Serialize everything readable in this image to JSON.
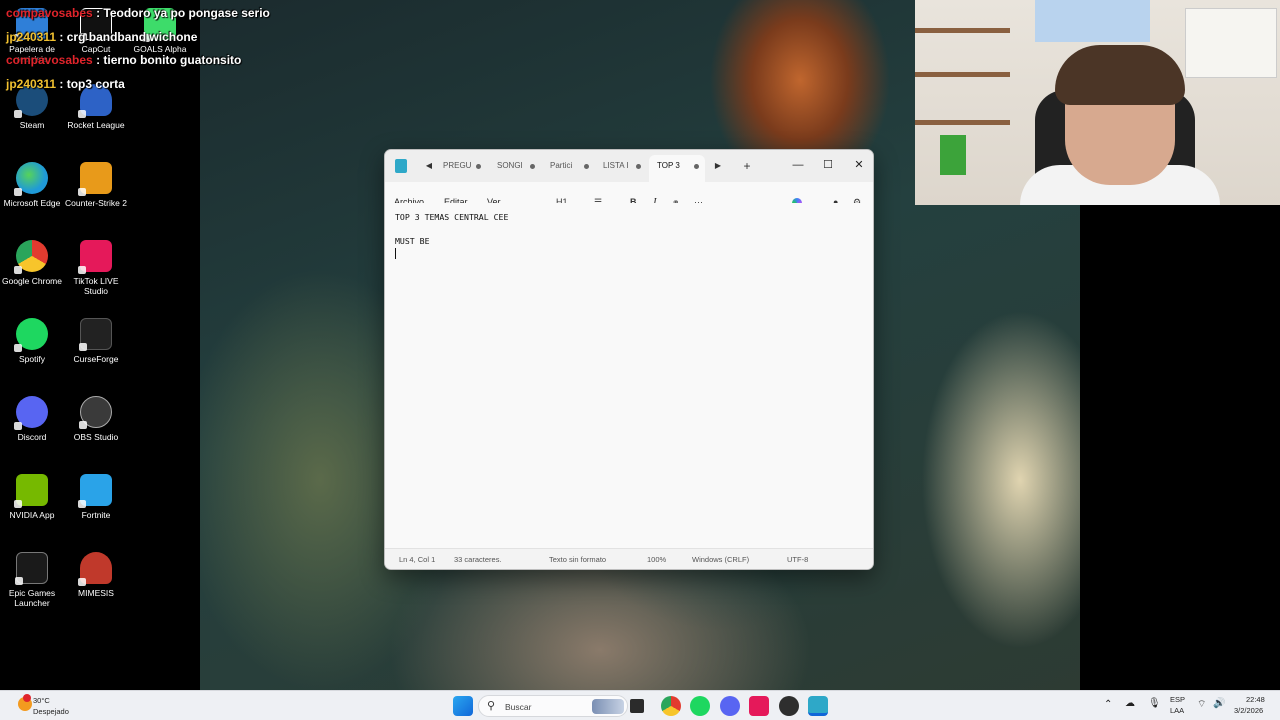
{
  "chat": [
    {
      "user": "compavosabes",
      "msg": "Teodoro ya po pongase serio",
      "color": "#e0242b"
    },
    {
      "user": "jp240311",
      "msg": "crg bandband wichone",
      "color": "#f0c030"
    },
    {
      "user": "compavosabes",
      "msg": "tierno bonito guatonsito",
      "color": "#e0242b"
    },
    {
      "user": "jp240311",
      "msg": "top3 corta",
      "color": "#f0c030"
    }
  ],
  "desktop_icons": [
    {
      "label": "Papelera de reciclaje",
      "icon": "recycle-bin-icon",
      "color": "#2f7fd8"
    },
    {
      "label": "CapCut",
      "icon": "capcut-icon",
      "color": "#111111"
    },
    {
      "label": "GOALS Alpha",
      "icon": "goals-icon",
      "color": "#3ddc6a"
    },
    {
      "label": "Steam",
      "icon": "steam-icon",
      "color": "#1b4d7a"
    },
    {
      "label": "Rocket League",
      "icon": "rocket-league-icon",
      "color": "#2d62c6"
    },
    {
      "label": "Microsoft Edge",
      "icon": "edge-icon",
      "color": "#1f9ad8"
    },
    {
      "label": "Counter-Strike 2",
      "icon": "counter-strike-icon",
      "color": "#e89a1a"
    },
    {
      "label": "Google Chrome",
      "icon": "chrome-icon",
      "color": "#e23b2f"
    },
    {
      "label": "TikTok LIVE Studio",
      "icon": "tiktok-icon",
      "color": "#e5195a"
    },
    {
      "label": "Spotify",
      "icon": "spotify-icon",
      "color": "#1ed760"
    },
    {
      "label": "CurseForge",
      "icon": "curseforge-icon",
      "color": "#222222"
    },
    {
      "label": "Discord",
      "icon": "discord-icon",
      "color": "#5865f2"
    },
    {
      "label": "OBS Studio",
      "icon": "obs-icon",
      "color": "#3a3a3a"
    },
    {
      "label": "NVIDIA App",
      "icon": "nvidia-icon",
      "color": "#76b900"
    },
    {
      "label": "Fortnite",
      "icon": "fortnite-icon",
      "color": "#2aa3e8"
    },
    {
      "label": "Epic Games Launcher",
      "icon": "epic-games-icon",
      "color": "#1a1a1a"
    },
    {
      "label": "MIMESIS",
      "icon": "mimesis-icon",
      "color": "#c0392b"
    }
  ],
  "notepad": {
    "tabs": [
      "PREGU",
      "SONGI",
      "Partici",
      "LISTA I",
      "TOP 3"
    ],
    "active_tab": "TOP 3",
    "menus": [
      "Archivo",
      "Editar",
      "Ver"
    ],
    "heading_select": "H1",
    "content": [
      "TOP 3 TEMAS CENTRAL CEE",
      "",
      "MUST BE",
      ""
    ],
    "status": {
      "position": "Ln 4, Col 1",
      "chars": "33 caracteres.",
      "format": "Texto sin formato",
      "zoom": "100%",
      "line_ending": "Windows (CRLF)",
      "encoding": "UTF-8"
    }
  },
  "taskbar": {
    "weather_temp": "30°C",
    "weather_desc": "Despejado",
    "search_placeholder": "Buscar",
    "language": "ESP",
    "layout": "LAA",
    "time": "22:48",
    "date": "3/2/2026"
  }
}
